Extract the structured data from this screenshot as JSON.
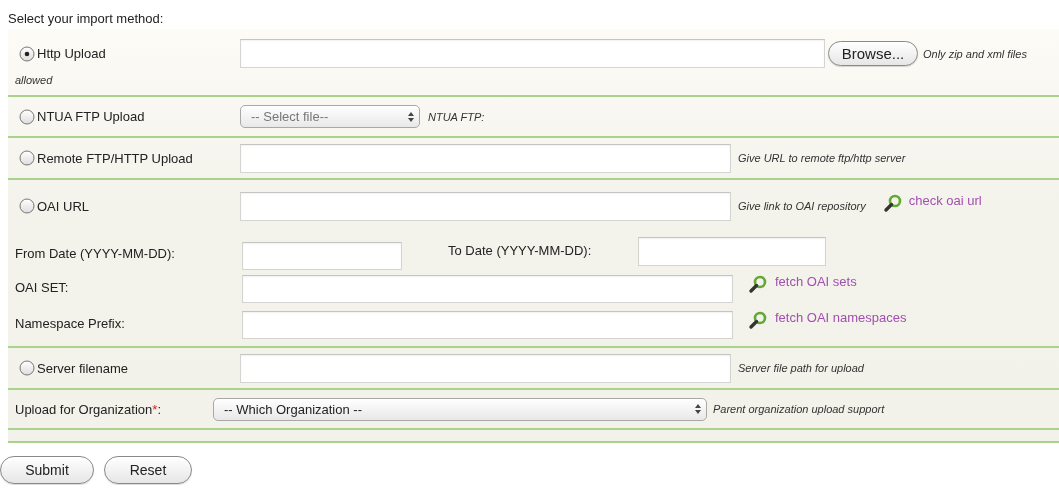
{
  "heading": "Select your import method:",
  "methods": [
    {
      "kind": "file",
      "label": "Http Upload",
      "selected": true,
      "button": "Browse...",
      "hint_lines": [
        "Only zip and xml files",
        "allowed"
      ]
    },
    {
      "kind": "select",
      "label": "NTUA FTP Upload",
      "selected": false,
      "value": "-- Select file--",
      "hint": "NTUA FTP:"
    },
    {
      "kind": "text",
      "label": "Remote FTP/HTTP Upload",
      "selected": false,
      "hint": "Give URL to remote ftp/http server"
    },
    {
      "kind": "oai",
      "label": "OAI URL",
      "selected": false,
      "hint": "Give link to OAI repository",
      "link": "check oai url",
      "from_label": "From Date (YYYY-MM-DD):",
      "to_label": "To Date (YYYY-MM-DD):",
      "set_label": "OAI SET:",
      "set_link": "fetch OAI sets",
      "namespace_label": "Namespace Prefix:",
      "namespace_link": "fetch OAI namespaces"
    },
    {
      "kind": "text",
      "label": "Server filename",
      "selected": false,
      "hint": "Server file path for upload"
    }
  ],
  "organization": {
    "label": "Upload for Organization",
    "required_mark": "*",
    "label_end": ":",
    "value": "-- Which Organization --",
    "hint": "Parent organization upload support"
  },
  "buttons": [
    {
      "label": "Submit"
    },
    {
      "label": "Reset"
    }
  ]
}
